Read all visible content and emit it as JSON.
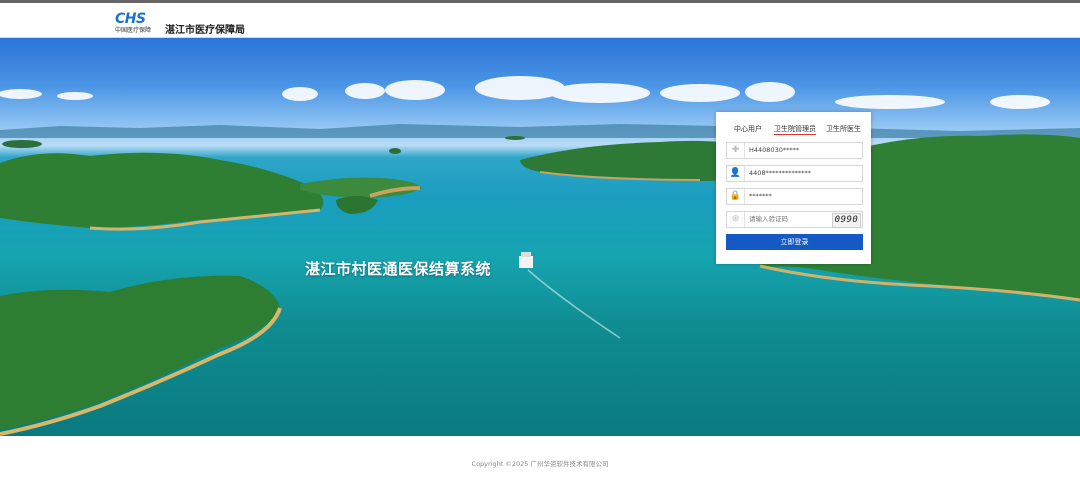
{
  "header": {
    "logo_mark": "CHS",
    "logo_sub": "中国医疗保障",
    "org_name": "湛江市医疗保障局"
  },
  "hero": {
    "system_title": "湛江市村医通医保结算系统"
  },
  "login": {
    "tabs": [
      {
        "label": "中心用户",
        "active": false
      },
      {
        "label": "卫生院管理员",
        "active": true
      },
      {
        "label": "卫生所医生",
        "active": false
      }
    ],
    "org_code_value": "H4408030*****",
    "account_value": "4408**************",
    "password_value": "*******",
    "captcha_placeholder": "请输入验证码",
    "captcha_code": "0990",
    "submit_label": "立即登录"
  },
  "footer": {
    "copyright": "Copyright ©2025 广州华资软件技术有限公司"
  },
  "colors": {
    "accent": "#1459c4",
    "tab_underline": "#dd3333"
  },
  "icons": [
    "plus-icon",
    "user-icon",
    "lock-icon",
    "shield-icon"
  ]
}
